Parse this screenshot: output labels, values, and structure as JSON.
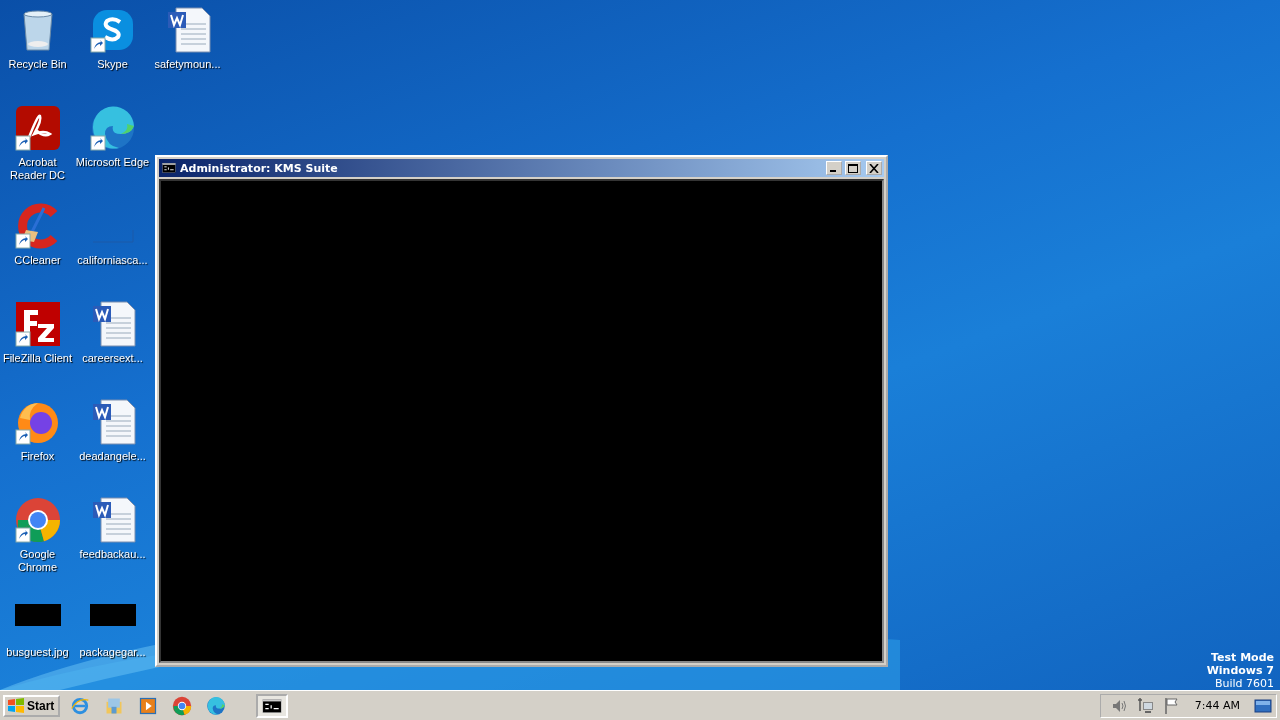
{
  "desktop": {
    "icons": [
      {
        "label": "Recycle Bin",
        "kind": "recycle",
        "shortcut": false
      },
      {
        "label": "Acrobat Reader DC",
        "kind": "acrobat",
        "shortcut": true
      },
      {
        "label": "CCleaner",
        "kind": "ccleaner",
        "shortcut": true
      },
      {
        "label": "FileZilla Client",
        "kind": "filezilla",
        "shortcut": true
      },
      {
        "label": "Firefox",
        "kind": "firefox",
        "shortcut": true
      },
      {
        "label": "Google Chrome",
        "kind": "chrome",
        "shortcut": true
      },
      {
        "label": "busguest.jpg",
        "kind": "image",
        "shortcut": false
      },
      {
        "label": "Skype",
        "kind": "skype",
        "shortcut": true
      },
      {
        "label": "Microsoft Edge",
        "kind": "edge",
        "shortcut": true
      },
      {
        "label": "californiasca...",
        "kind": "blank",
        "shortcut": false
      },
      {
        "label": "careersext...",
        "kind": "word",
        "shortcut": false
      },
      {
        "label": "deadangele...",
        "kind": "word",
        "shortcut": false
      },
      {
        "label": "feedbackau...",
        "kind": "word",
        "shortcut": false
      },
      {
        "label": "packagegar...",
        "kind": "image",
        "shortcut": false
      },
      {
        "label": "safetymoun...",
        "kind": "word",
        "shortcut": false
      }
    ]
  },
  "window": {
    "title": "Administrator:  KMS Suite"
  },
  "system_text": [
    "Test Mode",
    "Windows 7",
    "Build 7601"
  ],
  "taskbar": {
    "start": "Start",
    "items": [
      {
        "kind": "ie",
        "selected": false
      },
      {
        "kind": "explorer",
        "selected": false
      },
      {
        "kind": "media",
        "selected": false
      },
      {
        "kind": "chrome",
        "selected": false
      },
      {
        "kind": "edge",
        "selected": false
      },
      {
        "kind": "console",
        "selected": true
      }
    ],
    "clock": "7:44 AM"
  }
}
